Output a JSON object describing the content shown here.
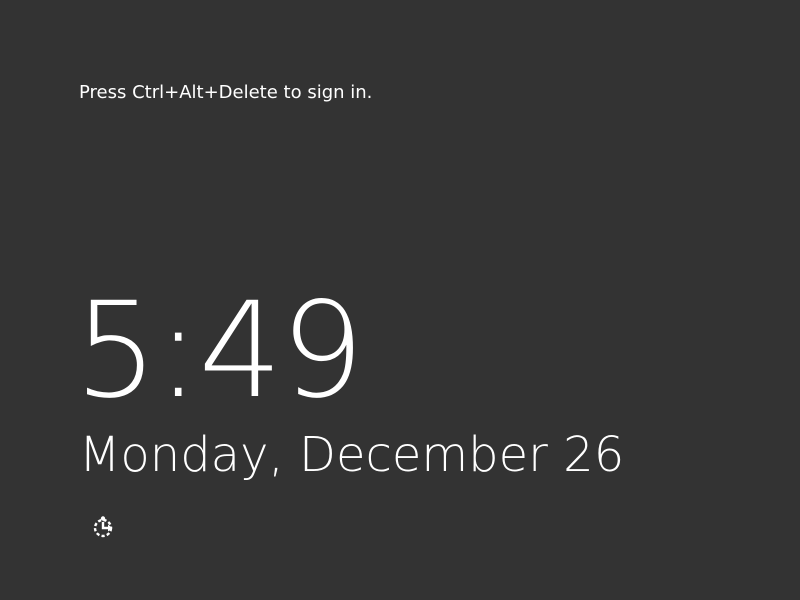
{
  "lock_screen": {
    "prompt": "Press Ctrl+Alt+Delete to sign in.",
    "time": "5:49",
    "date": "Monday, December 26",
    "ease_of_access_icon": "ease-of-access-icon"
  },
  "colors": {
    "background": "#333333",
    "text": "#ffffff"
  }
}
